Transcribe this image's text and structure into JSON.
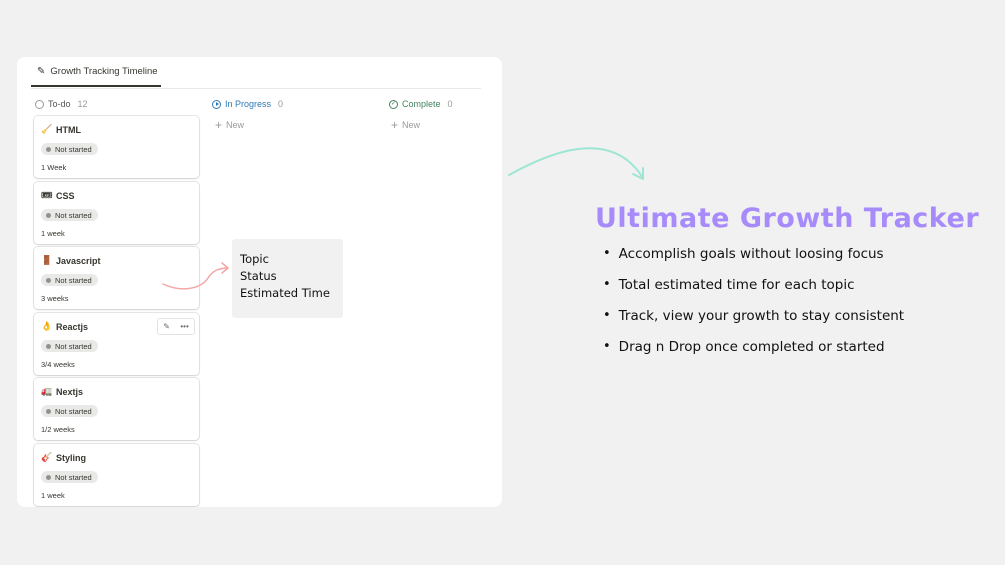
{
  "board": {
    "tab_label": "Growth Tracking Timeline",
    "tab_icon": "notes-pencil-icon",
    "columns": [
      {
        "title": "To-do",
        "count": "12",
        "color": "#55534e"
      },
      {
        "title": "In Progress",
        "count": "0",
        "color": "#2e7bb6",
        "new_label": "New"
      },
      {
        "title": "Complete",
        "count": "0",
        "color": "#448361",
        "new_label": "New"
      }
    ],
    "cards": [
      {
        "emoji": "🧹",
        "title": "HTML",
        "status": "Not started",
        "estimate": "1 Week"
      },
      {
        "emoji": "🎟",
        "title": "CSS",
        "status": "Not started",
        "estimate": "1 week"
      },
      {
        "emoji": "🚪",
        "title": "Javascript",
        "status": "Not started",
        "estimate": "3 weeks"
      },
      {
        "emoji": "👌",
        "title": "Reactjs",
        "status": "Not started",
        "estimate": "3/4 weeks"
      },
      {
        "emoji": "🚛",
        "title": "Nextjs",
        "status": "Not started",
        "estimate": "1/2 weeks"
      },
      {
        "emoji": "🎸",
        "title": "Styling",
        "status": "Not started",
        "estimate": "1 week"
      }
    ]
  },
  "legend": {
    "lines": [
      "Topic",
      "Status",
      "Estimated Time"
    ]
  },
  "hero": {
    "title": "Ultimate Growth Tracker",
    "title_color": "#a78bfa",
    "bullets": [
      "Accomplish goals without loosing focus",
      "Total estimated time for each topic",
      "Track, view your growth to stay consistent",
      "Drag n Drop once completed or started"
    ]
  },
  "colors": {
    "background": "#f1f1f1",
    "arrow_teal": "#9ee6d3",
    "arrow_pink": "#f4a6a6"
  }
}
